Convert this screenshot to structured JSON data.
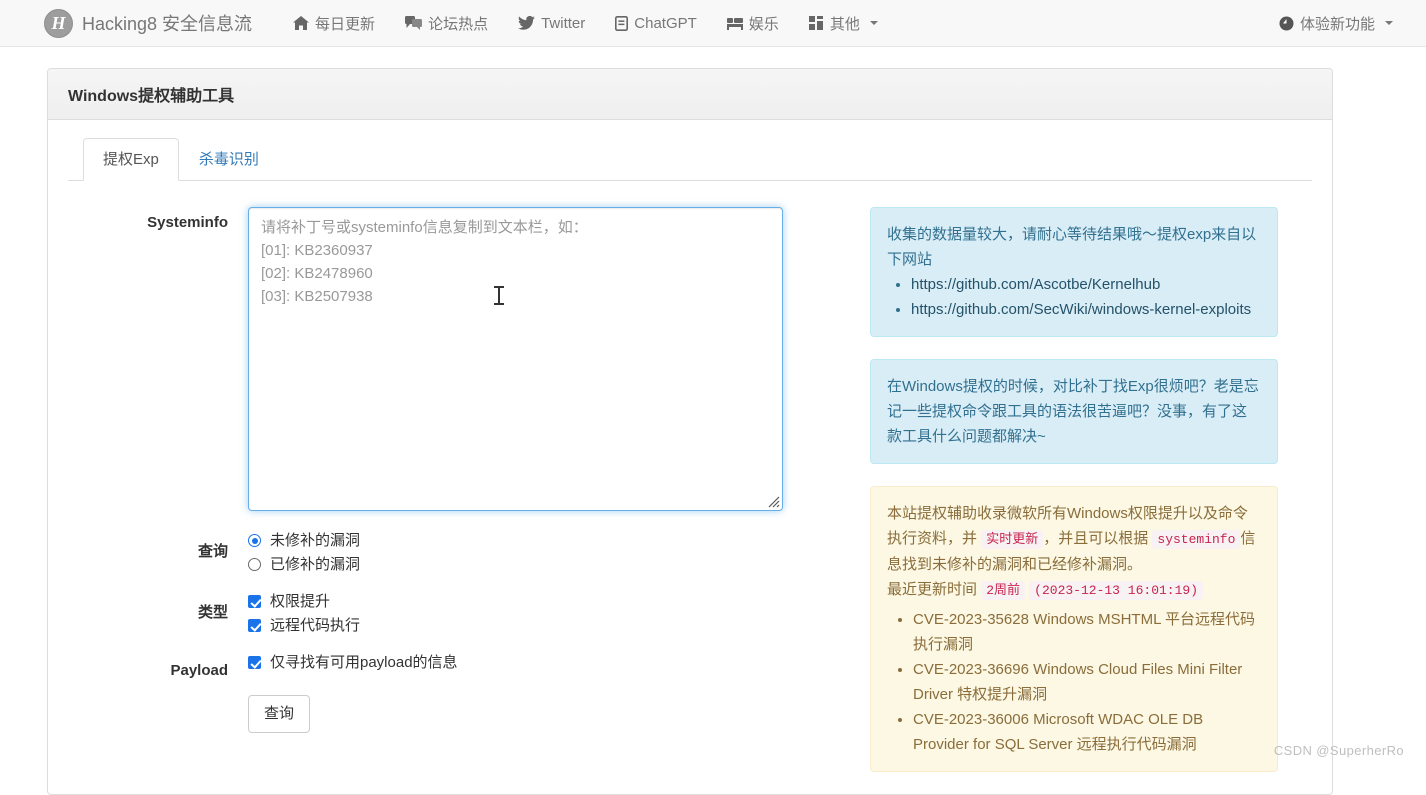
{
  "navbar": {
    "brand": {
      "logo_letter": "H",
      "text": "Hacking8 安全信息流"
    },
    "items": [
      {
        "icon": "home-icon",
        "label": "每日更新"
      },
      {
        "icon": "comments-icon",
        "label": "论坛热点"
      },
      {
        "icon": "twitter-icon",
        "label": "Twitter"
      },
      {
        "icon": "file-icon",
        "label": "ChatGPT"
      },
      {
        "icon": "bed-icon",
        "label": "娱乐"
      },
      {
        "icon": "grid-icon",
        "label": "其他",
        "caret": true
      }
    ],
    "right": {
      "icon": "clock-icon",
      "label": "体验新功能",
      "caret": true
    }
  },
  "panel": {
    "title": "Windows提权辅助工具",
    "tabs": [
      {
        "label": "提权Exp",
        "active": true
      },
      {
        "label": "杀毒识别",
        "active": false
      }
    ]
  },
  "form": {
    "systeminfo": {
      "label": "Systeminfo",
      "placeholder_lines": [
        "请将补丁号或systeminfo信息复制到文本栏，如：",
        "[01]: KB2360937",
        "[02]: KB2478960",
        "[03]: KB2507938"
      ],
      "value": ""
    },
    "query": {
      "label": "查询",
      "options": [
        {
          "label": "未修补的漏洞",
          "checked": true
        },
        {
          "label": "已修补的漏洞",
          "checked": false
        }
      ]
    },
    "type": {
      "label": "类型",
      "options": [
        {
          "label": "权限提升",
          "checked": true
        },
        {
          "label": "远程代码执行",
          "checked": true
        }
      ]
    },
    "payload": {
      "label": "Payload",
      "options": [
        {
          "label": "仅寻找有可用payload的信息",
          "checked": true
        }
      ]
    },
    "submit_label": "查询"
  },
  "side": {
    "info1": {
      "text": "收集的数据量较大，请耐心等待结果哦～提权exp来自以下网站",
      "links": [
        "https://github.com/Ascotbe/Kernelhub",
        "https://github.com/SecWiki/windows-kernel-exploits"
      ]
    },
    "info2": {
      "text": "在Windows提权的时候，对比补丁找Exp很烦吧？老是忘记一些提权命令跟工具的语法很苦逼吧？没事，有了这款工具什么问题都解决~"
    },
    "warning": {
      "part1": "本站提权辅助收录微软所有Windows权限提升以及命令执行资料，并",
      "code1": "实时更新",
      "part2": "，并且可以根据",
      "code2": "systeminfo",
      "part3": "信息找到未修补的漏洞和已经修补漏洞。",
      "updated_label": "最近更新时间",
      "updated_relative": "2周前",
      "updated_absolute": "(2023-12-13 16:01:19)",
      "cve_list": [
        "CVE-2023-35628 Windows MSHTML 平台远程代码执行漏洞",
        "CVE-2023-36696 Windows Cloud Files Mini Filter Driver 特权提升漏洞",
        "CVE-2023-36006 Microsoft WDAC OLE DB Provider for SQL Server 远程执行代码漏洞"
      ]
    }
  },
  "watermark": "CSDN @SuperherRo",
  "colors": {
    "nav_bg": "#f8f8f8",
    "link": "#337ab7",
    "info_bg": "#d9edf7",
    "info_text": "#31708f",
    "warning_bg": "#fcf8e3",
    "warning_text": "#8a6d3b",
    "code_text": "#c7254e",
    "accent_blue": "#1a73e8"
  }
}
